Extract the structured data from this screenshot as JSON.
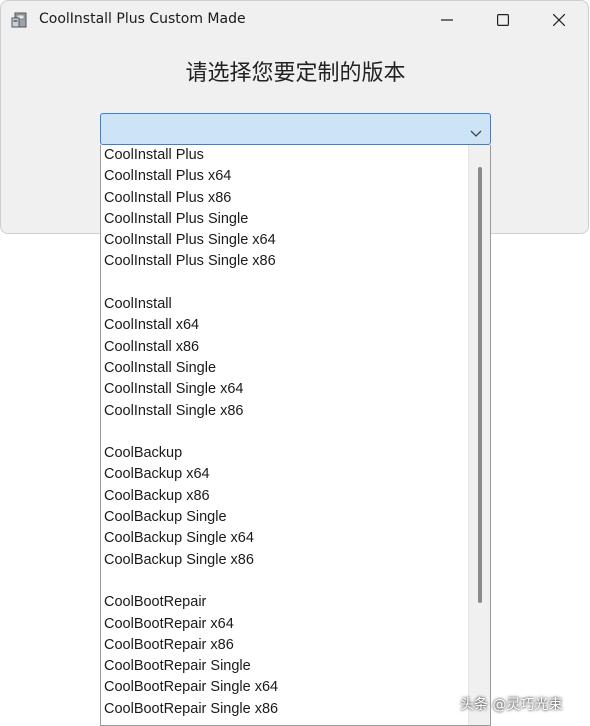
{
  "window": {
    "title": "CoolInstall Plus Custom Made"
  },
  "heading": "请选择您要定制的版本",
  "combo": {
    "selected": ""
  },
  "dropdown": {
    "items": [
      "CoolInstall Plus",
      "CoolInstall Plus x64",
      "CoolInstall Plus x86",
      "CoolInstall Plus Single",
      "CoolInstall Plus Single x64",
      "CoolInstall Plus Single x86",
      "",
      "CoolInstall",
      "CoolInstall x64",
      "CoolInstall x86",
      "CoolInstall Single",
      "CoolInstall Single x64",
      "CoolInstall Single x86",
      "",
      "CoolBackup",
      "CoolBackup x64",
      "CoolBackup x86",
      "CoolBackup Single",
      "CoolBackup Single x64",
      "CoolBackup Single x86",
      "",
      "CoolBootRepair",
      "CoolBootRepair x64",
      "CoolBootRepair x86",
      "CoolBootRepair Single",
      "CoolBootRepair Single x64",
      "CoolBootRepair Single x86"
    ]
  },
  "watermark": "头条 @灵巧光束",
  "colors": {
    "combo_border": "#3c7dd8",
    "combo_fill": "#cde4f7",
    "window_bg": "#f0f0f0"
  }
}
